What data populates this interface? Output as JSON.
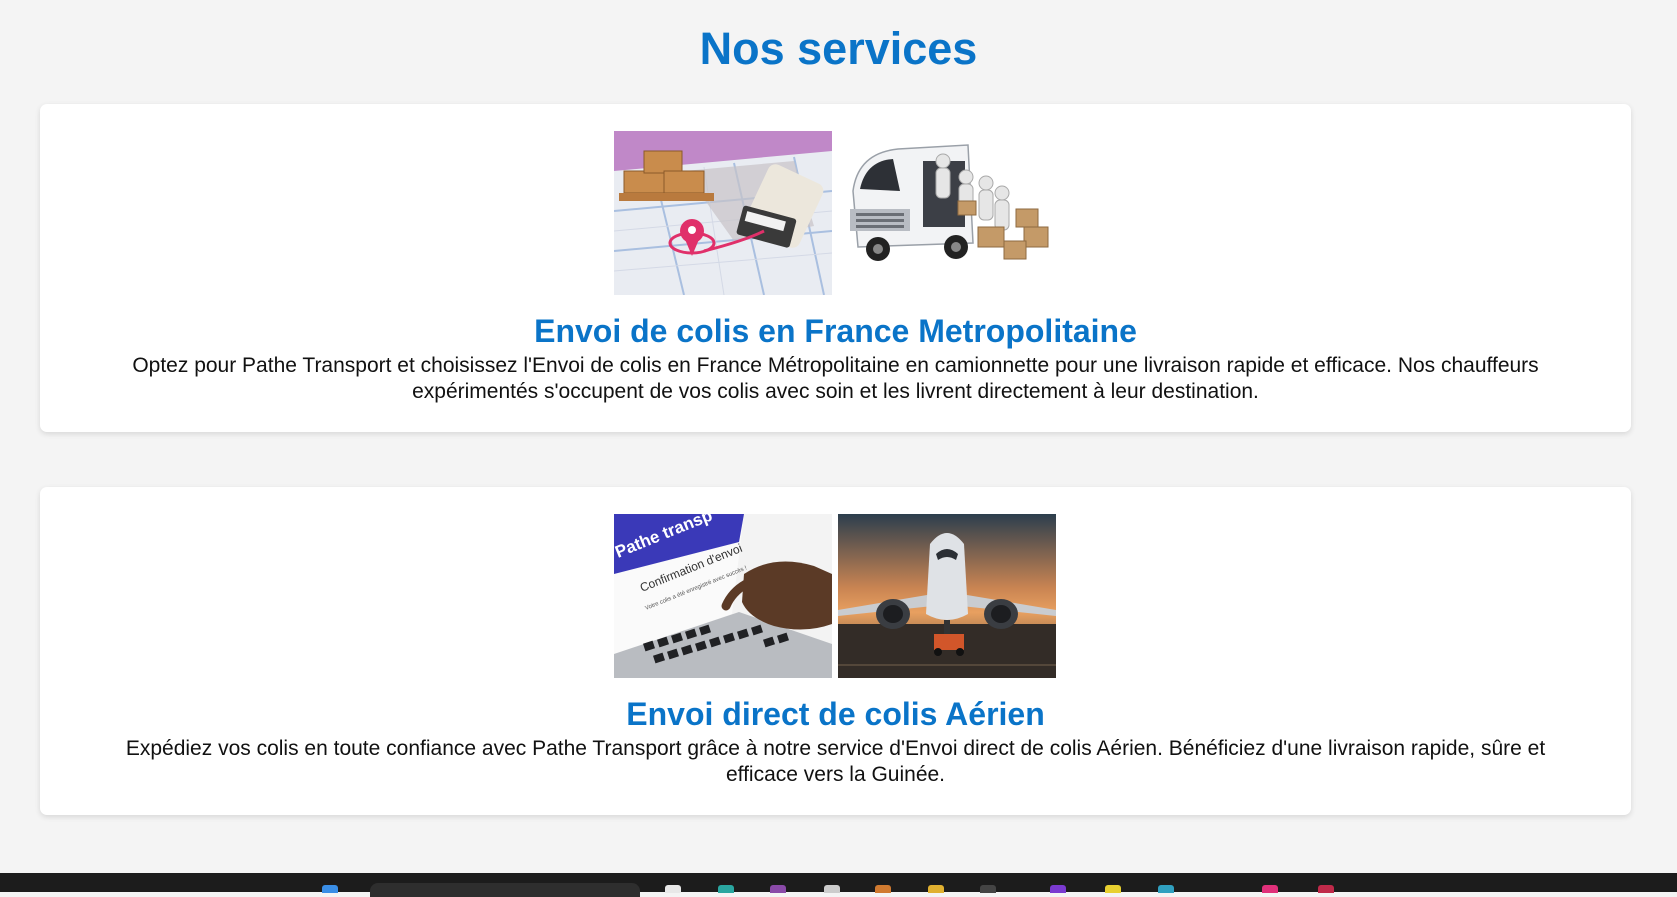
{
  "page": {
    "title": "Nos services"
  },
  "services": [
    {
      "title": "Envoi de colis en France Metropolitaine",
      "description": "Optez pour Pathe Transport et choisissez l'Envoi de colis en France Métropolitaine en camionnette pour une livraison rapide et efficace. Nos chauffeurs expérimentés s'occupent de vos colis avec soin et les livrent directement à leur destination.",
      "images": [
        "parcel-map-delivery-image",
        "van-delivery-image"
      ]
    },
    {
      "title": "Envoi direct de colis Aérien",
      "description": "Expédiez vos colis en toute confiance avec Pathe Transport grâce à notre service d'Envoi direct de colis Aérien. Bénéficiez d'une livraison rapide, sûre et efficace vers la Guinée.",
      "images": [
        "laptop-confirmation-image",
        "airplane-image"
      ],
      "laptop_screen": {
        "brand": "Pathe transp",
        "heading": "Confirmation d'envoi",
        "message": "Votre colis a été enregistré avec succès !"
      }
    }
  ],
  "colors": {
    "accent": "#0a74c8",
    "background": "#f4f4f4",
    "card": "#ffffff",
    "taskbar": "#1c1c1c"
  }
}
